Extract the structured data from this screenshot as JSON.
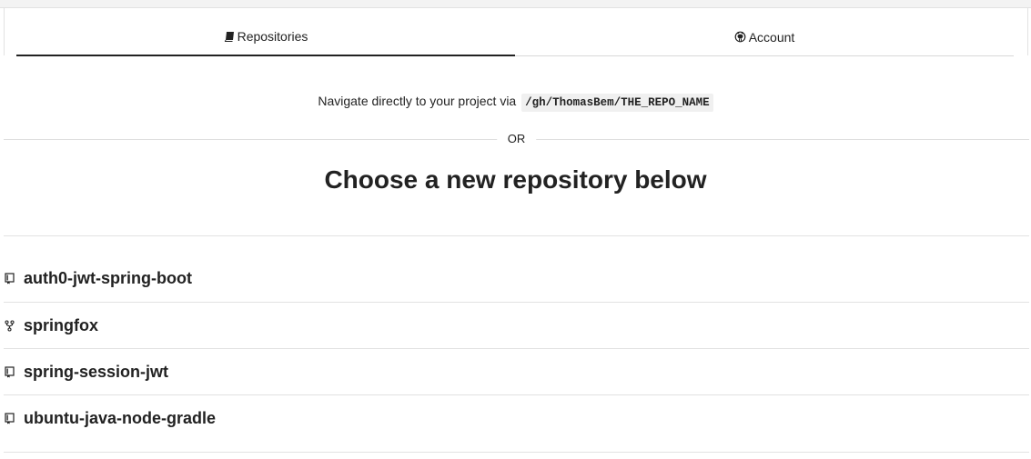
{
  "tabs": [
    {
      "label": "Repositories",
      "icon": "book-icon",
      "active": true
    },
    {
      "label": "Account",
      "icon": "octocat-icon",
      "active": false
    }
  ],
  "navigate": {
    "text": "Navigate directly to your project via",
    "path": "/gh/ThomasBem/THE_REPO_NAME"
  },
  "or_label": "OR",
  "heading": "Choose a new repository below",
  "repositories": [
    {
      "name": "auth0-jwt-spring-boot",
      "icon": "repo-icon"
    },
    {
      "name": "springfox",
      "icon": "fork-icon"
    },
    {
      "name": "spring-session-jwt",
      "icon": "repo-icon"
    },
    {
      "name": "ubuntu-java-node-gradle",
      "icon": "repo-icon"
    }
  ]
}
